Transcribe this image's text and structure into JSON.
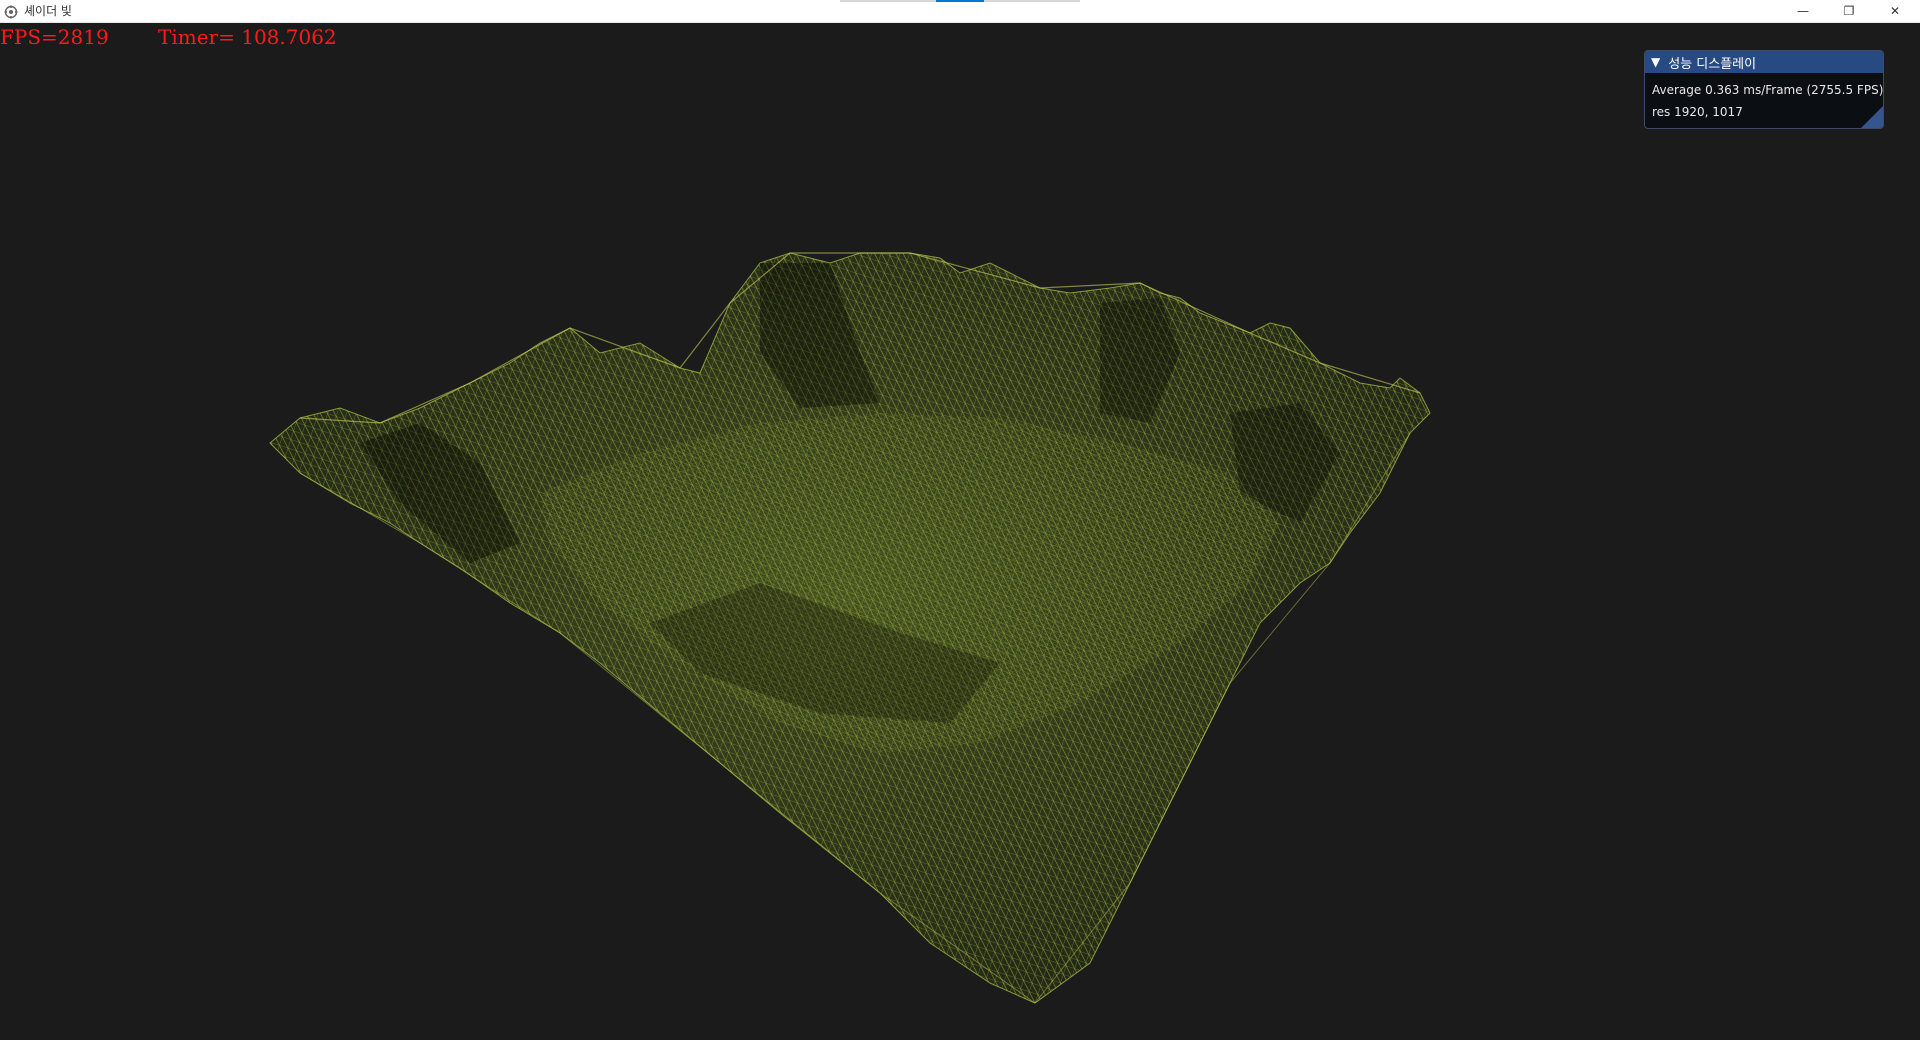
{
  "window": {
    "title": "셰이더 빛",
    "controls": {
      "minimize": "—",
      "maximize": "❐",
      "close": "✕"
    }
  },
  "hud": {
    "fps": "FPS=2819",
    "timer": "Timer= 108.7062",
    "color": "#ff1a1a"
  },
  "perf_window": {
    "title": "성능 디스플레이",
    "collapse_icon": "triangle-down-icon",
    "average": "Average 0.363 ms/Frame (2755.5 FPS)",
    "resolution": "res 1920, 1017",
    "header_color": "#284a82"
  },
  "scene": {
    "background": "#1b1b1b",
    "wireframe_color": "#6f8a2a",
    "wireframe_highlight": "#c9cf5a"
  }
}
